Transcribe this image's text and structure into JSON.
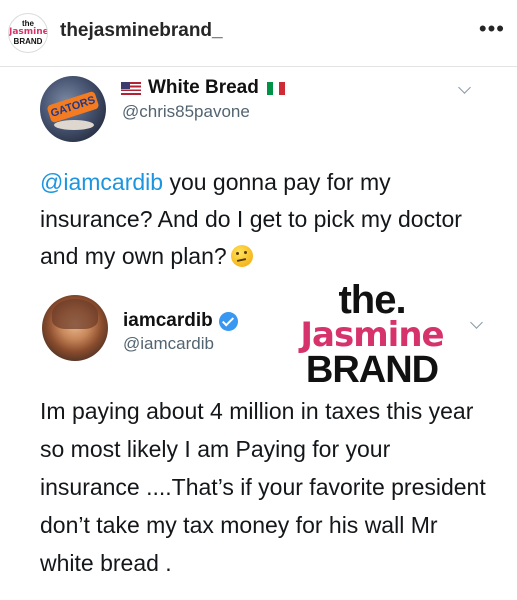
{
  "header": {
    "brand_avatar_lines": [
      "the",
      "Jasmine",
      "BRAND"
    ],
    "username": "thejasminebrand_",
    "more_label": "•••"
  },
  "original_tweet": {
    "avatar_cap_text": "GATORS",
    "display_name": "White Bread",
    "handle": "@chris85pavone",
    "mention": "@iamcardib",
    "text": " you gonna pay for my insurance? And do I get to pick my doctor and my own plan?",
    "icons": [
      "us-flag-icon",
      "italy-flag-icon",
      "thinking-face-icon",
      "chevron-down-icon"
    ]
  },
  "reply_tweet": {
    "display_name": "iamcardib",
    "handle": "@iamcardib",
    "text": "Im paying about 4 million in taxes this year so most likely I am Paying for your insurance ....That’s if your favorite president don’t take my tax money for his wall Mr white bread .",
    "icons": [
      "verified-badge-icon",
      "chevron-down-icon"
    ]
  },
  "watermark": {
    "line1": "the.",
    "line2": "Jasmine",
    "line3": "BRAND"
  },
  "colors": {
    "mention_blue": "#1b95e0",
    "verified_blue": "#3897f0",
    "brand_pink": "#d6336c",
    "handle_gray": "#536471"
  }
}
